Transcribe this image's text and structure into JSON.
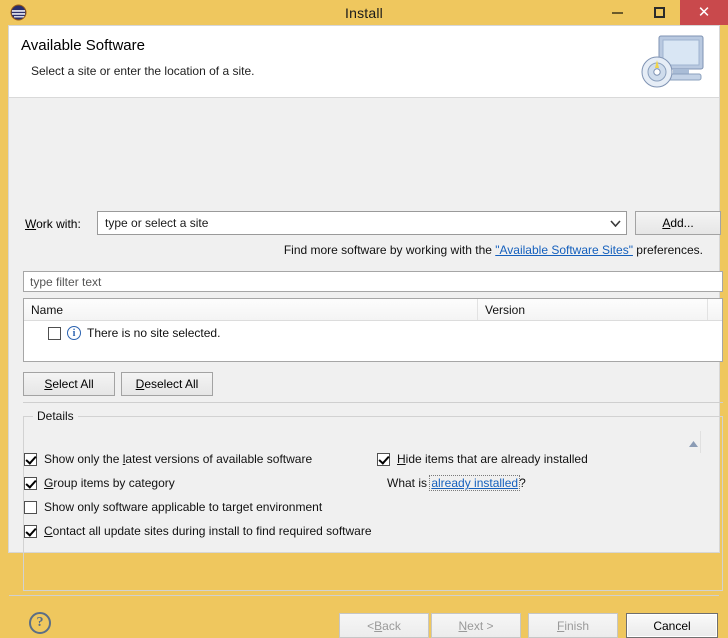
{
  "window": {
    "title": "Install",
    "app_icon": "eclipse-icon",
    "controls": {
      "minimize": "minimize-icon",
      "maximize": "maximize-icon",
      "close": "close-icon"
    },
    "colors": {
      "titlebar": "#efc75e",
      "close_button": "#c9494c",
      "dialog_background": "#f0f0f0",
      "link": "#1560bd"
    }
  },
  "header": {
    "title": "Available Software",
    "subtitle": "Select a site or enter the location of a site.",
    "icon": "computer-disc-icon"
  },
  "work_with": {
    "label": "Work with:",
    "label_mnemonic": "W",
    "combo_value": "type or select a site",
    "combo_placeholder": "type or select a site",
    "dropdown_icon": "chevron-down-icon",
    "add_button": "Add...",
    "add_button_mnemonic": "A"
  },
  "hint": {
    "prefix": "Find more software by working with the ",
    "link": "\"Available Software Sites\"",
    "suffix": " preferences."
  },
  "filter": {
    "placeholder": "type filter text",
    "value": ""
  },
  "table": {
    "columns": [
      "Name",
      "Version"
    ],
    "rows": [
      {
        "checked": false,
        "icon": "info-icon",
        "name": "There is no site selected.",
        "version": ""
      }
    ]
  },
  "selection_buttons": {
    "select_all": "Select All",
    "select_all_mnemonic": "S",
    "deselect_all": "Deselect All",
    "deselect_all_mnemonic": "D"
  },
  "details": {
    "legend": "Details",
    "scroll_up_icon": "scroll-up-arrow-icon",
    "options_left": [
      {
        "label": "Show only the latest versions of available software",
        "checked": true
      },
      {
        "label": "Group items by category",
        "checked": true
      },
      {
        "label": "Show only software applicable to target environment",
        "checked": false
      },
      {
        "label": "Contact all update sites during install to find required software",
        "checked": true
      }
    ],
    "options_right": [
      {
        "label": "Hide items that are already installed",
        "checked": true
      }
    ],
    "what_is": {
      "prefix": "What is ",
      "link": "already installed",
      "suffix": "?"
    }
  },
  "footer": {
    "help_icon": "help-question-icon",
    "buttons": [
      {
        "label": "< Back",
        "enabled": false
      },
      {
        "label": "Next >",
        "enabled": false
      },
      {
        "label": "Finish",
        "enabled": false
      },
      {
        "label": "Cancel",
        "enabled": true,
        "default": true
      }
    ]
  }
}
